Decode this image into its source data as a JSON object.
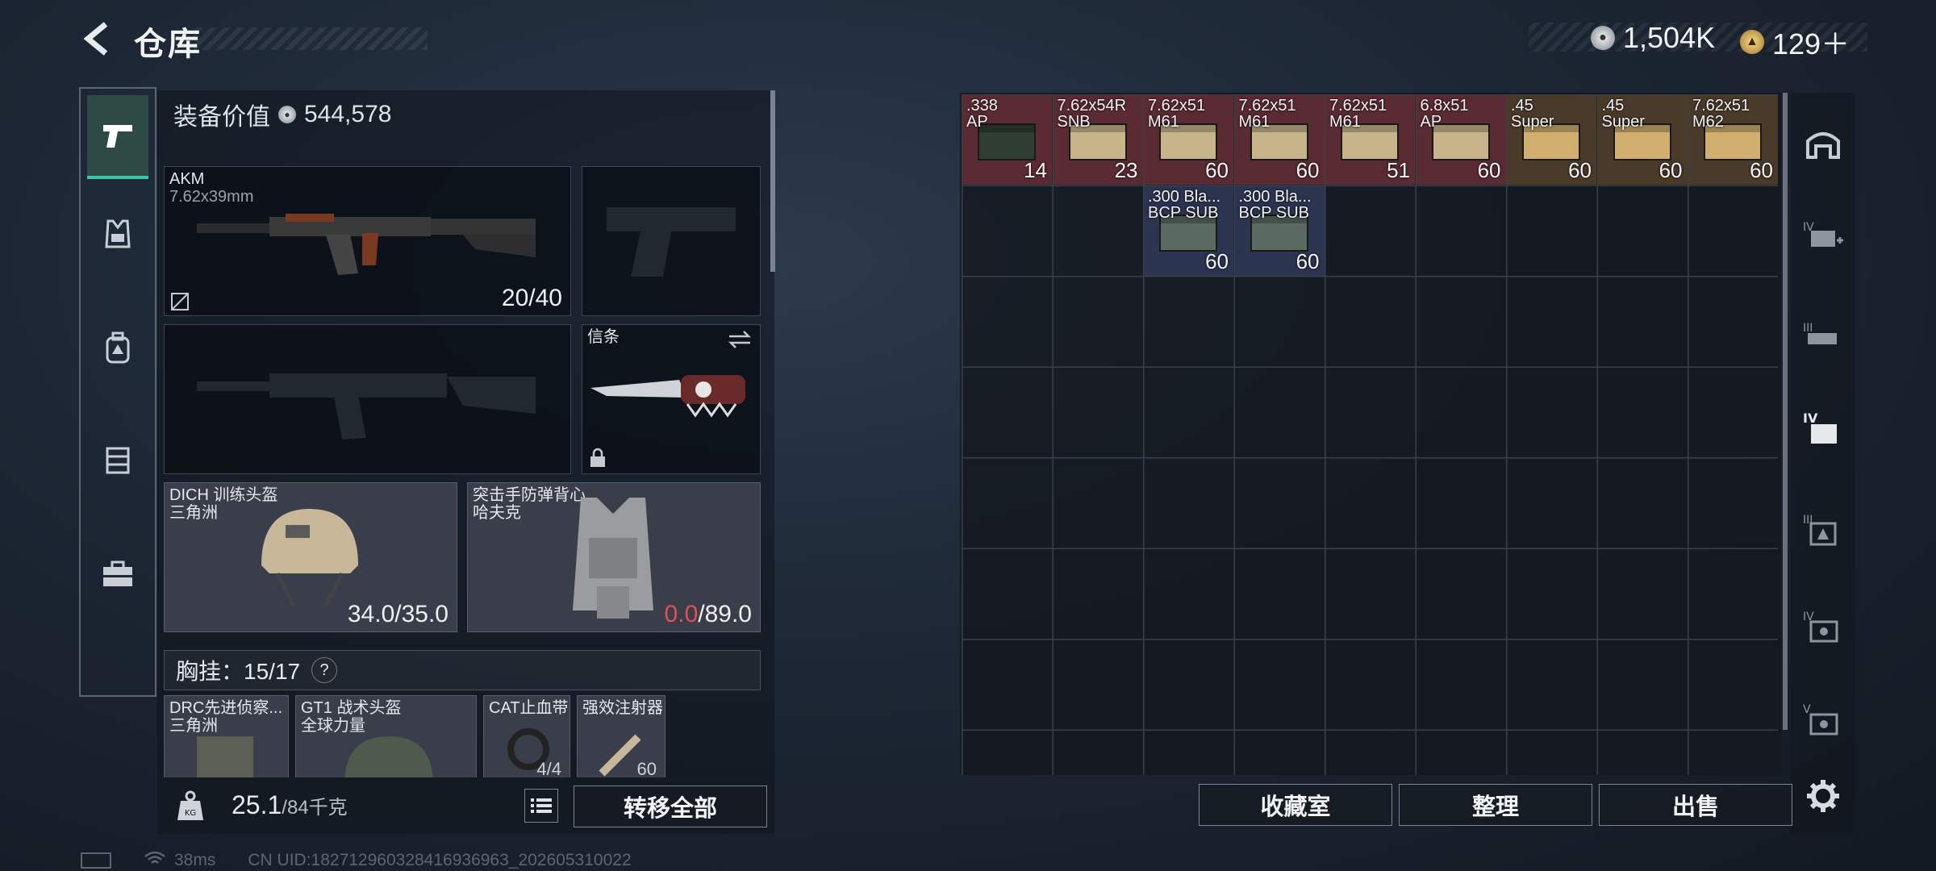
{
  "header": {
    "title": "仓库"
  },
  "currency": {
    "silver": "1,504K",
    "gold": "129＋"
  },
  "left_rail": {
    "items": [
      "weapons-icon",
      "vest-icon",
      "backpack-icon",
      "rig-icon",
      "briefcase-icon"
    ]
  },
  "equipment": {
    "value_label": "装备价值",
    "value": "544,578",
    "primary": {
      "name": "AKM",
      "caliber": "7.62x39mm",
      "ammo": "20/40"
    },
    "melee": {
      "name": "信条"
    },
    "helmet": {
      "name": "DICH 训练头盔",
      "faction": "三角洲",
      "dur_cur": "34.0",
      "dur_max": "/35.0"
    },
    "armor": {
      "name": "突击手防弹背心",
      "faction": "哈夫克",
      "dur_cur": "0.0",
      "dur_max": "/89.0"
    },
    "chest": {
      "label": "胸挂：",
      "count": "15/17",
      "help": "?"
    },
    "chest_items": [
      {
        "name": "DRC先进侦察...",
        "sub": "三角洲"
      },
      {
        "name": "GT1 战术头盔",
        "sub": "全球力量"
      },
      {
        "name": "CAT止血带",
        "sub": "",
        "qty": "4/4"
      },
      {
        "name": "强效注射器",
        "sub": "",
        "qty": "60"
      }
    ]
  },
  "bottom_left": {
    "weight": "25.1",
    "capacity": "/84千克",
    "transfer_all": "转移全部"
  },
  "stash": {
    "items": [
      {
        "name": ".338\nAP",
        "qty": "14",
        "color": "red"
      },
      {
        "name": "7.62x54R\nSNB",
        "qty": "23",
        "color": "red"
      },
      {
        "name": "7.62x51\nM61",
        "qty": "60",
        "color": "red"
      },
      {
        "name": "7.62x51\nM61",
        "qty": "60",
        "color": "red"
      },
      {
        "name": "7.62x51\nM61",
        "qty": "51",
        "color": "red"
      },
      {
        "name": "6.8x51\nAP",
        "qty": "60",
        "color": "red"
      },
      {
        "name": ".45\nSuper",
        "qty": "60",
        "color": "gold"
      },
      {
        "name": ".45\nSuper",
        "qty": "60",
        "color": "gold"
      },
      {
        "name": "7.62x51\nM62",
        "qty": "60",
        "color": "gold"
      },
      {
        "name": ".300 Bla...\nBCP SUB",
        "qty": "60",
        "color": "blue"
      },
      {
        "name": ".300 Bla...\nBCP SUB",
        "qty": "60",
        "color": "blue"
      }
    ]
  },
  "bottom_right": {
    "collection": "收藏室",
    "sort": "整理",
    "sell": "出售"
  },
  "status": {
    "ping": "38ms",
    "uid": "CN UID:1827129603284169369​63_202605310022"
  }
}
